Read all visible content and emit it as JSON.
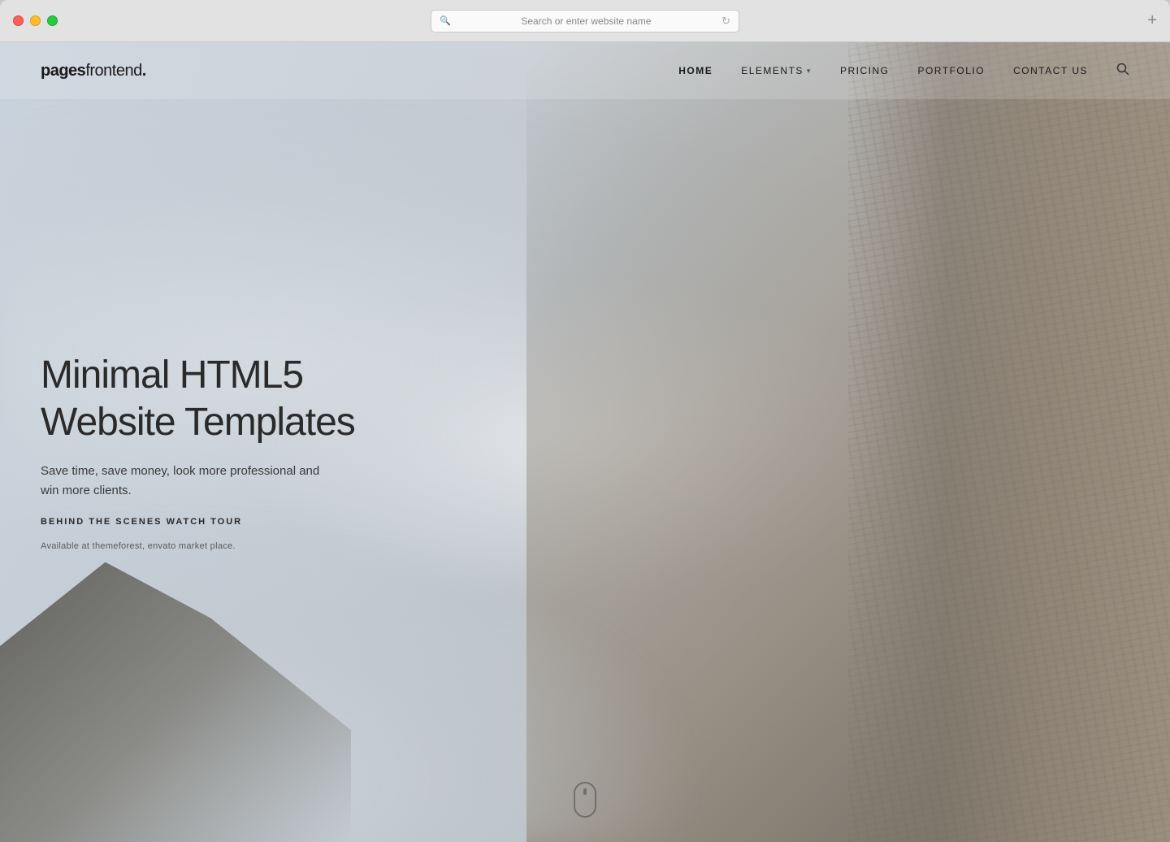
{
  "browser": {
    "address_bar_text": "Search or enter website name",
    "new_tab_icon": "+"
  },
  "logo": {
    "pages": "pages",
    "frontend": "frontend",
    "dot": "."
  },
  "nav": {
    "items": [
      {
        "label": "HOME",
        "active": true,
        "has_dropdown": false
      },
      {
        "label": "ELEMENTS",
        "active": false,
        "has_dropdown": true
      },
      {
        "label": "PRICING",
        "active": false,
        "has_dropdown": false
      },
      {
        "label": "PORTFOLIO",
        "active": false,
        "has_dropdown": false
      },
      {
        "label": "CONTACT US",
        "active": false,
        "has_dropdown": false
      }
    ],
    "search_icon": "🔍"
  },
  "hero": {
    "title": "Minimal HTML5 Website Templates",
    "subtitle": "Save time, save money, look more professional and win more clients.",
    "cta_label": "BEHIND THE SCENES WATCH TOUR",
    "note": "Available at themeforest, envato market place."
  }
}
